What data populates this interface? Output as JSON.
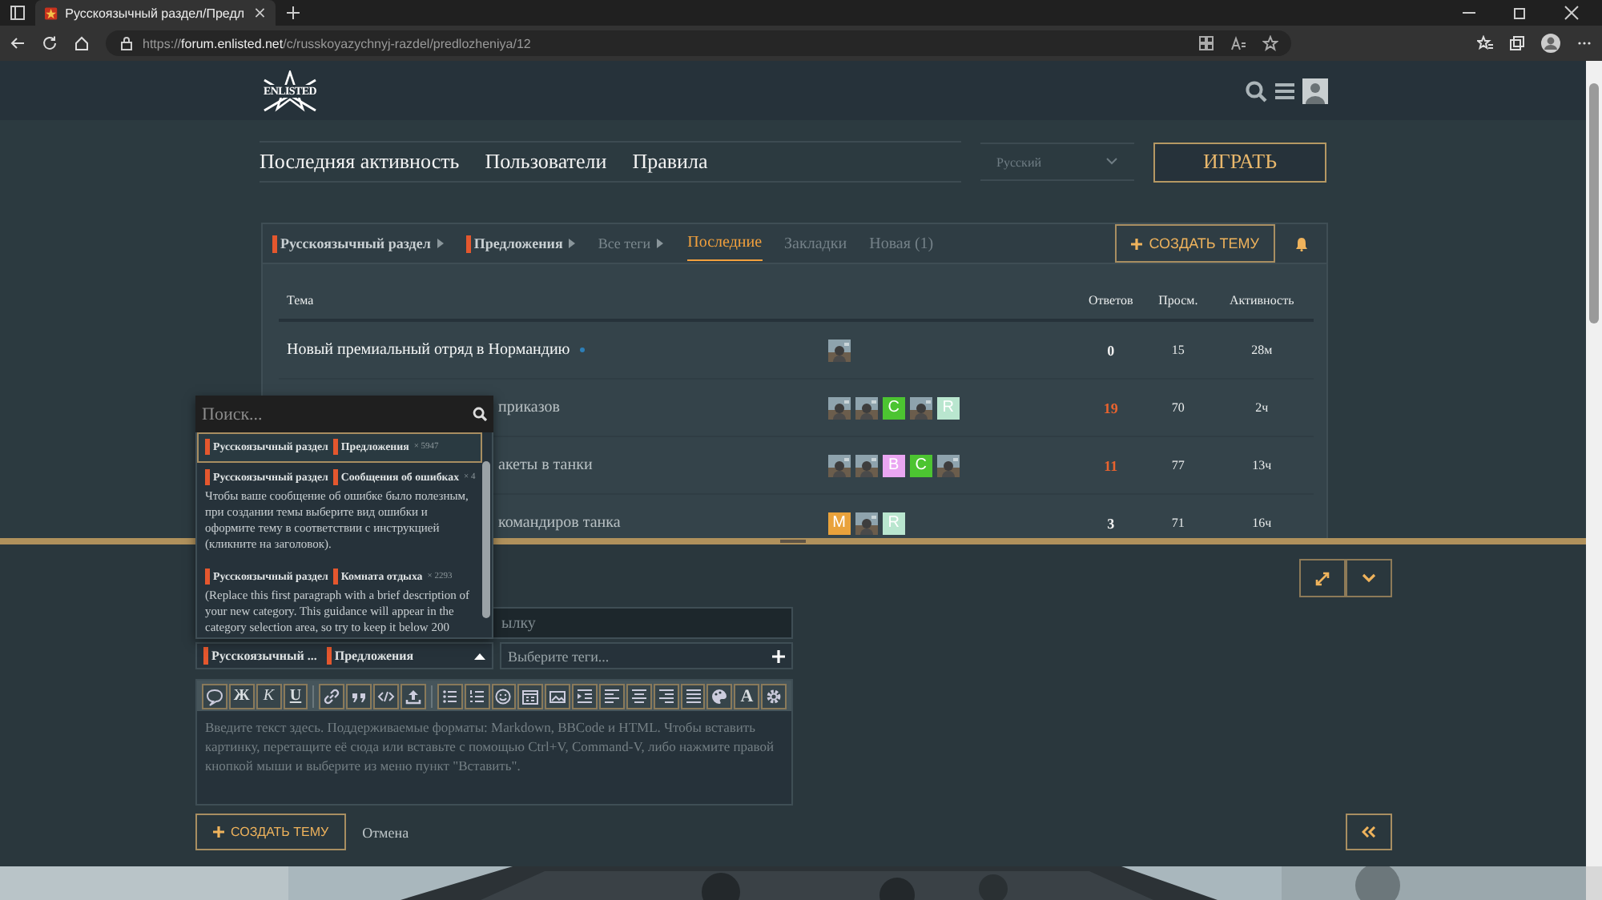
{
  "browser": {
    "tab_title": "Русскоязычный раздел/Предл",
    "url_scheme": "https://",
    "url_host": "forum.enlisted.net",
    "url_path": "/c/russkoyazychnyj-razdel/predlozheniya/12"
  },
  "header": {
    "logo": "ENLISTED"
  },
  "nav": {
    "links": [
      "Последняя активность",
      "Пользователи",
      "Правила"
    ],
    "language": "Русский",
    "play_button": "ИГРАТЬ"
  },
  "list_nav": {
    "breadcrumbs": [
      {
        "label": "Русскоязычный раздел",
        "color": "#e4572e"
      },
      {
        "label": "Предложения",
        "color": "#e4572e"
      },
      {
        "label": "Все теги"
      }
    ],
    "tabs": [
      {
        "label": "Последние",
        "selected": true
      },
      {
        "label": "Закладки",
        "selected": false
      },
      {
        "label": "Новая (1)",
        "selected": false
      }
    ],
    "create_button": "СОЗДАТЬ ТЕМУ"
  },
  "table": {
    "columns": [
      "Тема",
      "Ответов",
      "Просм.",
      "Активность"
    ],
    "rows": [
      {
        "title": "Новый премиальный отряд в Нормандию",
        "covered": false,
        "unread": true,
        "posters": [
          {
            "kind": "picture"
          }
        ],
        "replies": "0",
        "hot": false,
        "views": "15",
        "activity": "28м"
      },
      {
        "title": "приказов",
        "covered": true,
        "unread": false,
        "posters": [
          {
            "kind": "picture"
          },
          {
            "kind": "picture"
          },
          {
            "kind": "letter",
            "letter": "C",
            "color": "#4cc431"
          },
          {
            "kind": "picture"
          },
          {
            "kind": "letter",
            "letter": "R",
            "color": "#b9e6cf"
          }
        ],
        "replies": "19",
        "hot": true,
        "views": "70",
        "activity": "2ч"
      },
      {
        "title": "акеты в танки",
        "covered": true,
        "unread": false,
        "posters": [
          {
            "kind": "picture"
          },
          {
            "kind": "picture"
          },
          {
            "kind": "letter",
            "letter": "B",
            "color": "#eaa6f2"
          },
          {
            "kind": "letter",
            "letter": "C",
            "color": "#4cc431"
          },
          {
            "kind": "picture"
          }
        ],
        "replies": "11",
        "hot": true,
        "views": "77",
        "activity": "13ч"
      },
      {
        "title": "командиров танка",
        "covered": true,
        "unread": false,
        "posters": [
          {
            "kind": "letter",
            "letter": "M",
            "color": "#e9a23b"
          },
          {
            "kind": "picture"
          },
          {
            "kind": "letter",
            "letter": "R",
            "color": "#b9e6cf"
          }
        ],
        "replies": "3",
        "hot": false,
        "views": "71",
        "activity": "16ч"
      }
    ]
  },
  "composer": {
    "title_placeholder": "ылку",
    "category_chooser": {
      "open": true,
      "badges": [
        {
          "label": "Русскоязычный ...",
          "color": "#e4572e"
        },
        {
          "label": "Предложения",
          "color": "#e4572e"
        }
      ]
    },
    "tags_placeholder": "Выберите теги...",
    "editor_toolbar": [
      {
        "kind": "icon"
      },
      {
        "kind": "text",
        "label": "Ж"
      },
      {
        "kind": "text",
        "label": "К"
      },
      {
        "kind": "text",
        "label": "U"
      },
      {
        "kind": "sep"
      },
      {
        "kind": "icon"
      },
      {
        "kind": "icon"
      },
      {
        "kind": "icon"
      },
      {
        "kind": "icon"
      },
      {
        "kind": "sep"
      },
      {
        "kind": "icon"
      },
      {
        "kind": "icon"
      },
      {
        "kind": "icon"
      },
      {
        "kind": "icon"
      },
      {
        "kind": "icon"
      },
      {
        "kind": "icon"
      },
      {
        "kind": "icon"
      },
      {
        "kind": "icon"
      },
      {
        "kind": "icon"
      },
      {
        "kind": "icon"
      },
      {
        "kind": "icon"
      },
      {
        "kind": "text",
        "label": "A"
      },
      {
        "kind": "icon"
      }
    ],
    "editor_placeholder": "Введите текст здесь. Поддерживаемые форматы: Markdown, BBCode и HTML. Чтобы вставить картинку, перетащите её сюда или вставьте с помощью Ctrl+V, Command-V, либо нажмите правой кнопкой мыши и выберите из меню пункт \"Вставить\".",
    "create_button": "СОЗДАТЬ ТЕМУ",
    "cancel": "Отмена"
  },
  "category_dropdown": {
    "search_placeholder": "Поиск...",
    "items": [
      {
        "selected": true,
        "badges": [
          {
            "label": "Русскоязычный раздел",
            "color": "#e4572e"
          },
          {
            "label": "Предложения",
            "color": "#e4572e"
          }
        ],
        "count": "× 5947"
      },
      {
        "selected": false,
        "badges": [
          {
            "label": "Русскоязычный раздел",
            "color": "#e4572e"
          },
          {
            "label": "Сообщения об ошибках",
            "color": "#e4572e"
          }
        ],
        "count": "× 4",
        "description": "Чтобы ваше сообщение об ошибке было полезным, при создании темы выберите вид ошибки и оформите тему в соответствии с инструкцией (кликните на заголовок)."
      },
      {
        "selected": false,
        "badges": [
          {
            "label": "Русскоязычный раздел",
            "color": "#e4572e"
          },
          {
            "label": "Комната отдыха",
            "color": "#e4572e"
          }
        ],
        "count": "× 2293",
        "description": "(Replace this first paragraph with a brief description of your new category. This guidance will appear in the category selection area, so try to keep it below 200"
      }
    ]
  }
}
